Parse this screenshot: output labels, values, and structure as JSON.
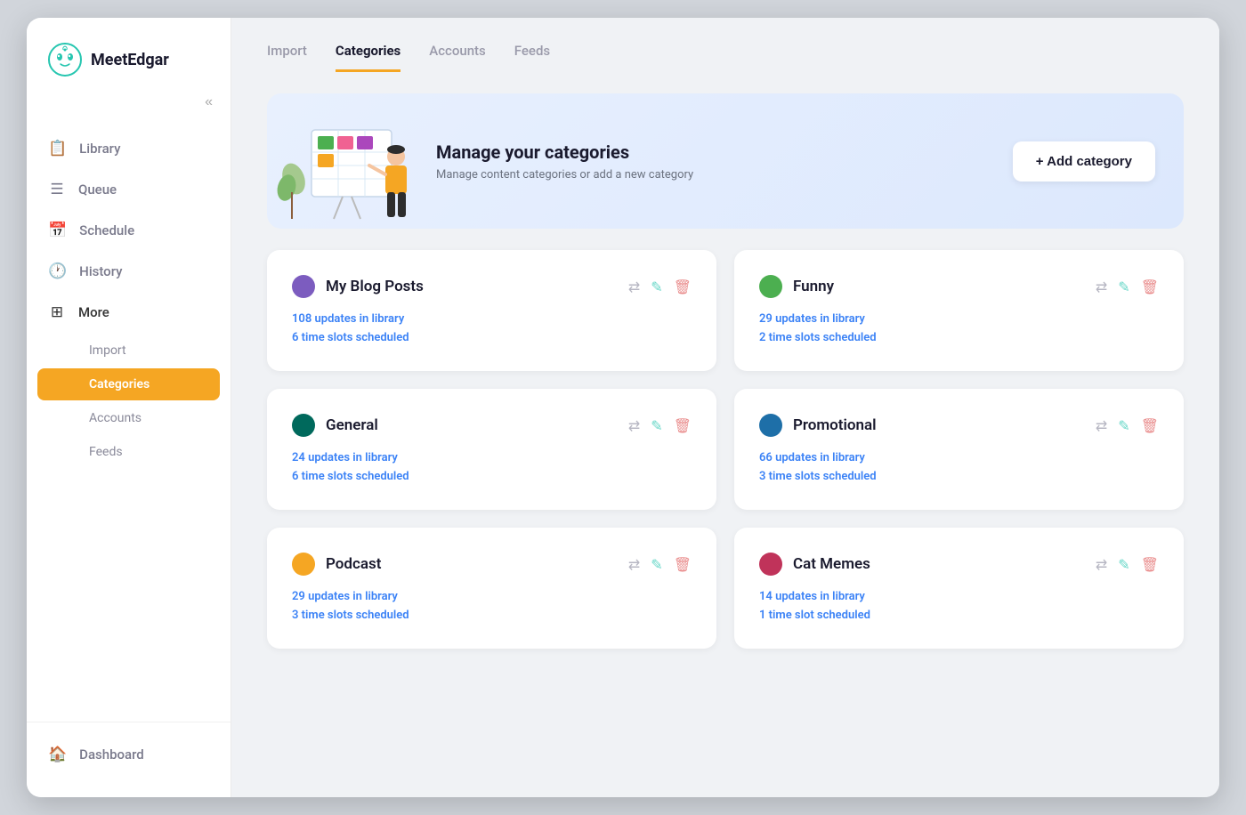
{
  "brand": {
    "name": "MeetEdgar"
  },
  "sidebar": {
    "collapse_label": "«",
    "nav_items": [
      {
        "id": "library",
        "label": "Library",
        "icon": "📋"
      },
      {
        "id": "queue",
        "label": "Queue",
        "icon": "☰"
      },
      {
        "id": "schedule",
        "label": "Schedule",
        "icon": "📅"
      },
      {
        "id": "history",
        "label": "History",
        "icon": "🕐"
      },
      {
        "id": "more",
        "label": "More",
        "icon": "⊞"
      }
    ],
    "sub_items": [
      {
        "id": "import",
        "label": "Import",
        "active": false
      },
      {
        "id": "categories",
        "label": "Categories",
        "active": true
      },
      {
        "id": "accounts",
        "label": "Accounts",
        "active": false
      },
      {
        "id": "feeds",
        "label": "Feeds",
        "active": false
      }
    ],
    "bottom_items": [
      {
        "id": "dashboard",
        "label": "Dashboard",
        "icon": "🏠"
      }
    ]
  },
  "tabs": [
    {
      "id": "import",
      "label": "Import",
      "active": false
    },
    {
      "id": "categories",
      "label": "Categories",
      "active": true
    },
    {
      "id": "accounts",
      "label": "Accounts",
      "active": false
    },
    {
      "id": "feeds",
      "label": "Feeds",
      "active": false
    }
  ],
  "hero": {
    "title": "Manage your categories",
    "subtitle": "Manage content categories or add a new category",
    "add_button": "+ Add category"
  },
  "categories": [
    {
      "id": "my-blog-posts",
      "name": "My Blog Posts",
      "color": "#7c5cbf",
      "updates": "108 updates in library",
      "slots": "6 time slots scheduled"
    },
    {
      "id": "funny",
      "name": "Funny",
      "color": "#4caf50",
      "updates": "29 updates in library",
      "slots": "2 time slots scheduled"
    },
    {
      "id": "general",
      "name": "General",
      "color": "#00695c",
      "updates": "24 updates in library",
      "slots": "6 time slots scheduled"
    },
    {
      "id": "promotional",
      "name": "Promotional",
      "color": "#1e6fa8",
      "updates": "66 updates in library",
      "slots": "3 time slots scheduled"
    },
    {
      "id": "podcast",
      "name": "Podcast",
      "color": "#f5a623",
      "updates": "29 updates in library",
      "slots": "3 time slots scheduled"
    },
    {
      "id": "cat-memes",
      "name": "Cat Memes",
      "color": "#c0335a",
      "updates": "14 updates in library",
      "slots": "1 time slot scheduled"
    }
  ]
}
